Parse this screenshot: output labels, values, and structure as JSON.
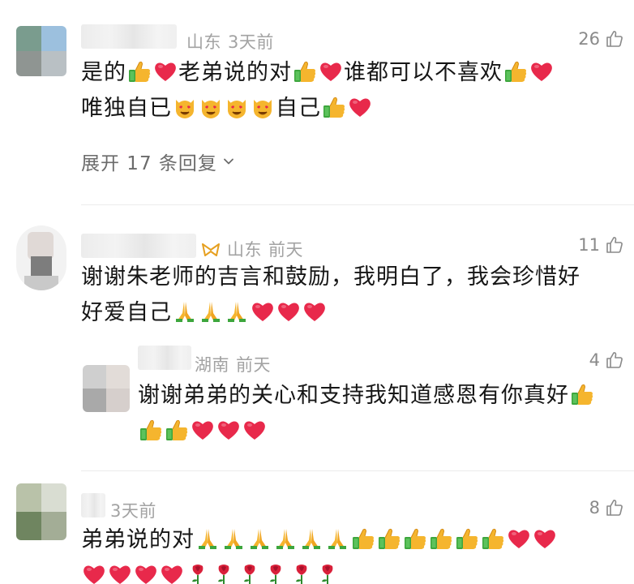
{
  "comments": [
    {
      "location": "山东",
      "time": "3天前",
      "likes": "26",
      "text_a": "是的",
      "text_b": "老弟说的对",
      "text_c": "谁都可以不喜欢",
      "text_d": "唯独自已",
      "text_e": "自己",
      "expand_label": "展开 17 条回复"
    },
    {
      "location": "山东",
      "time": "前天",
      "likes": "11",
      "line1": "谢谢朱老师的吉言和鼓励，我明白了，我会珍惜好",
      "line2": "好爱自己"
    },
    {
      "location": "湖南",
      "time": "前天",
      "likes": "4",
      "line1": "谢谢弟弟的关心和支持我知道感恩有你真好"
    },
    {
      "time": "3天前",
      "likes": "8",
      "line1": "弟弟说的对"
    }
  ],
  "icons": {
    "thumbs_up_emoji": "thumbs-up",
    "heart_emoji": "red-heart",
    "cat_heart_eyes": "smiling-cat-heart-eyes",
    "pray_emoji": "folded-hands",
    "rose_emoji": "rose",
    "like_icon": "like-outline",
    "chevron": "chevron-down"
  },
  "colors": {
    "heart": "#e8294b",
    "thumb": "#f5b52e",
    "cuff": "#3da63d",
    "meta": "#a3a3a3"
  }
}
